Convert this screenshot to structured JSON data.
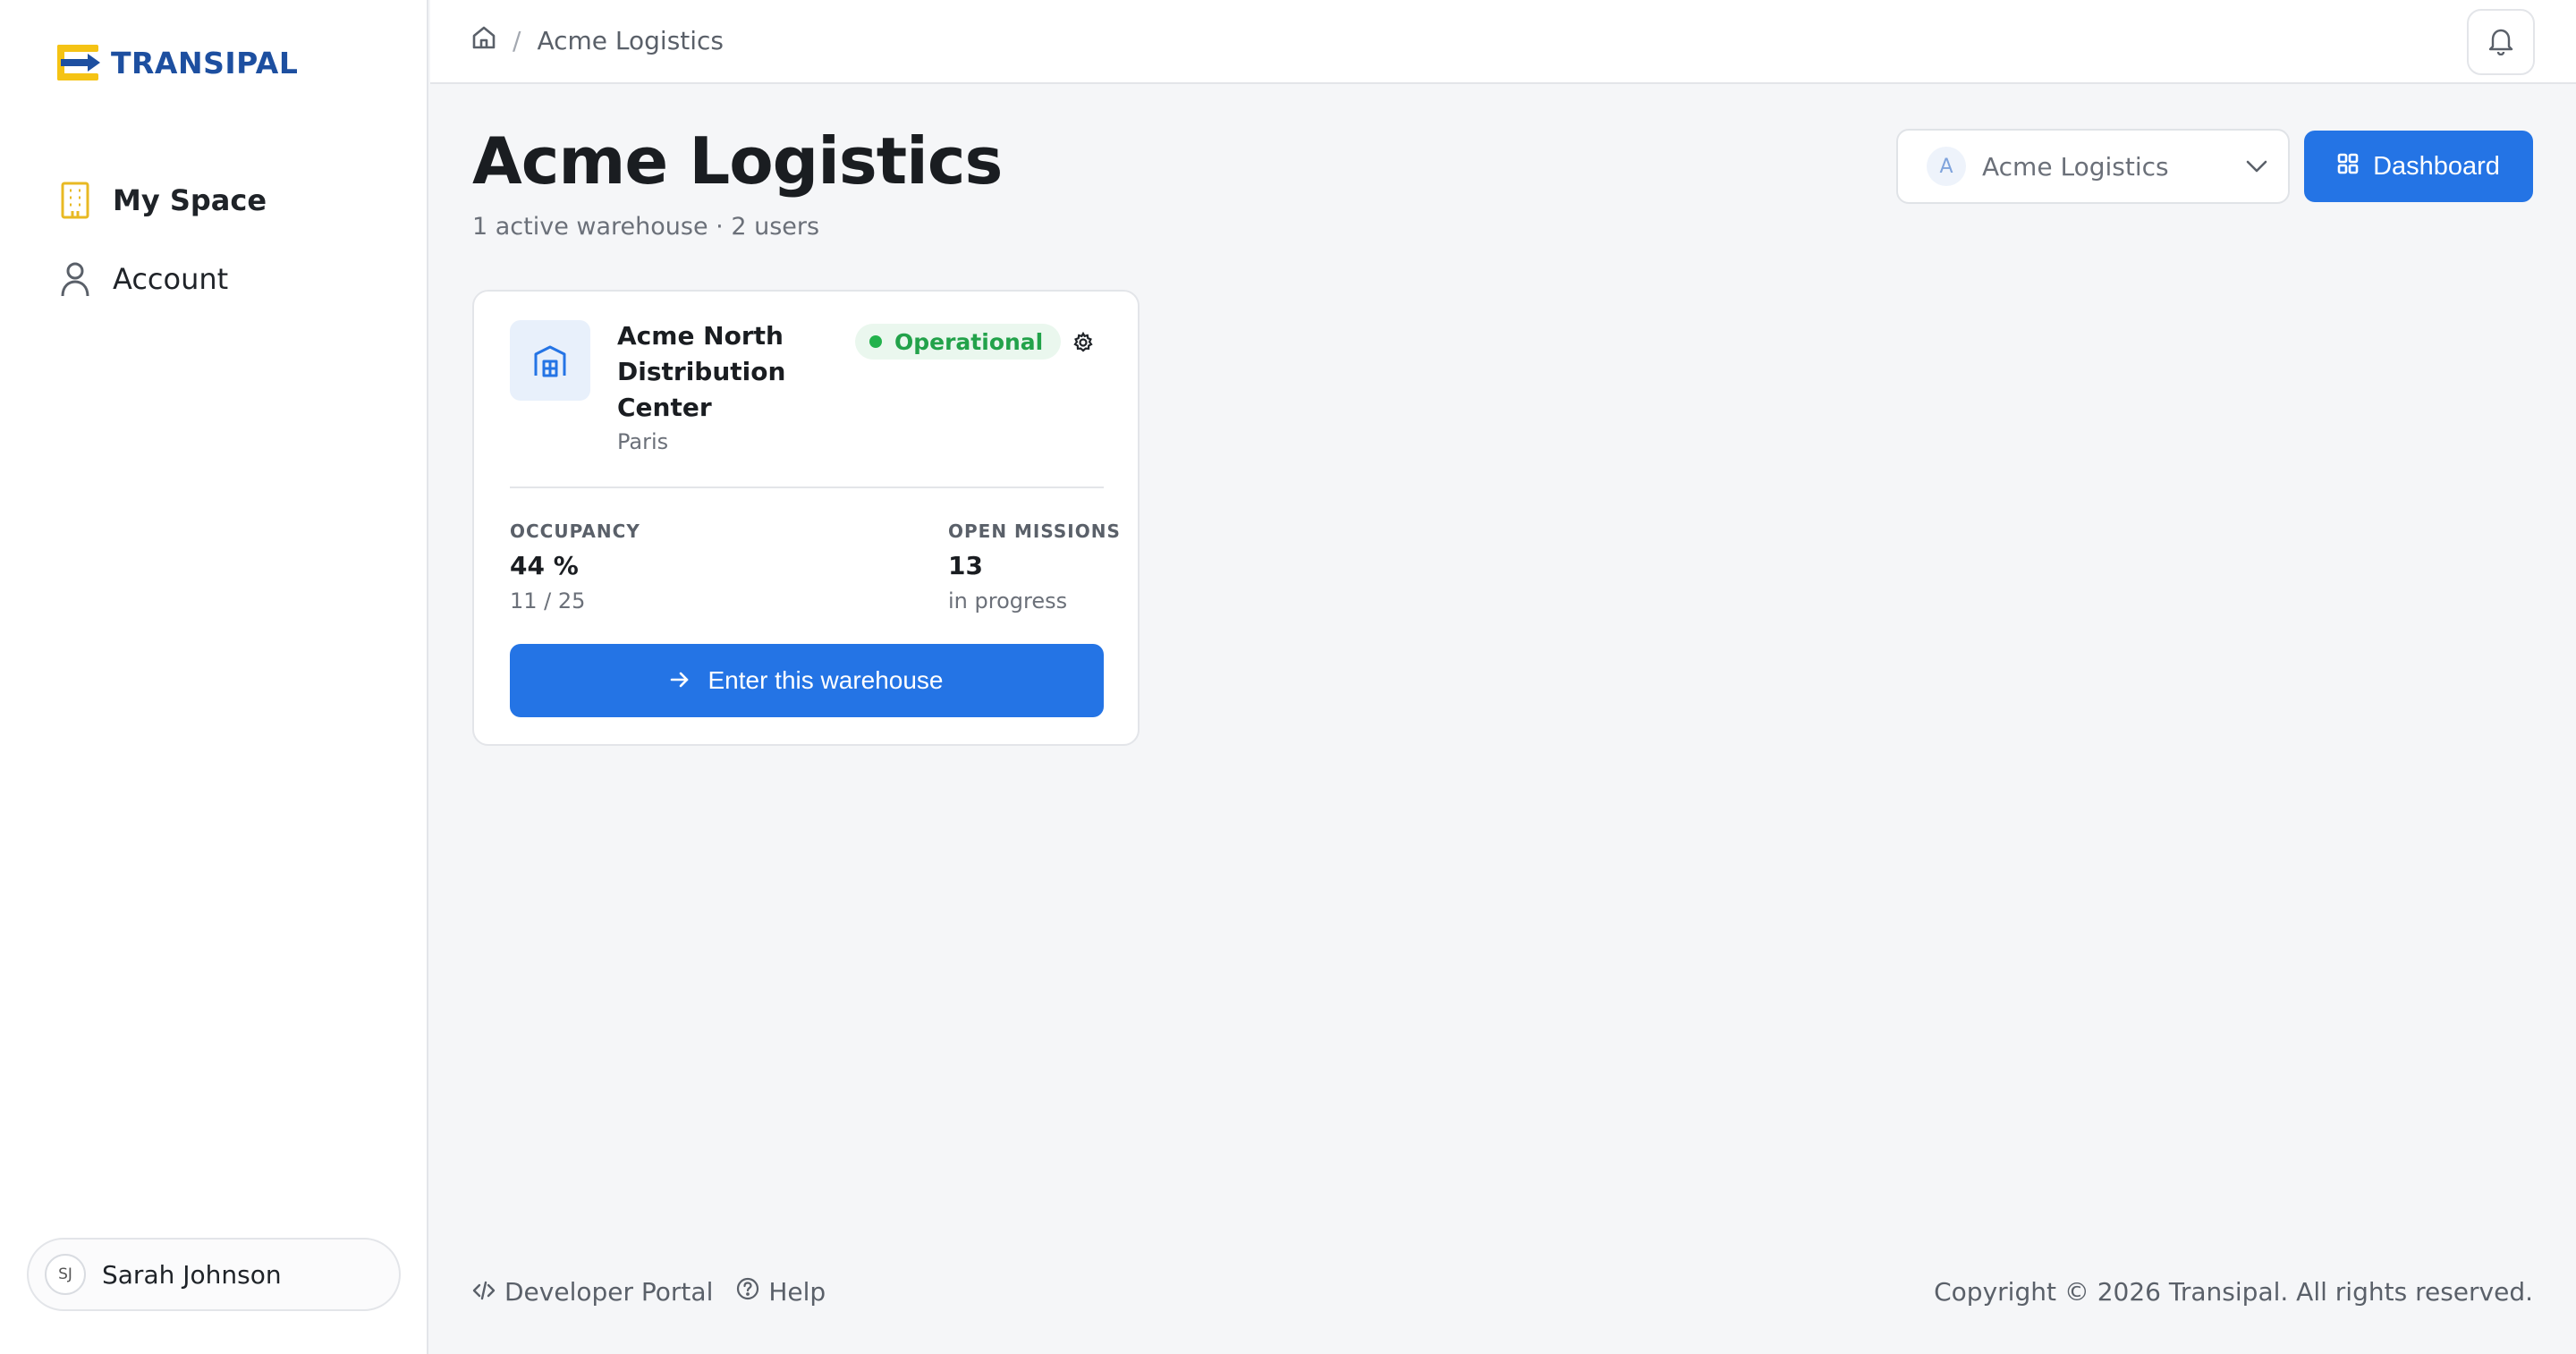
{
  "app": {
    "logo_text": "TRANSIPAL",
    "colors": {
      "brand_blue": "#1d4fa0",
      "brand_yellow": "#f5c314",
      "primary": "#2474e5",
      "success": "#22a24a"
    }
  },
  "sidebar": {
    "items": [
      {
        "label": "My Space",
        "icon": "building-icon",
        "active": true
      },
      {
        "label": "Account",
        "icon": "user-icon",
        "active": false
      }
    ],
    "user": {
      "initials": "SJ",
      "name": "Sarah Johnson"
    }
  },
  "topbar": {
    "breadcrumb": {
      "home_icon": "home-icon",
      "current": "Acme Logistics"
    },
    "bell_icon": "bell-icon"
  },
  "header": {
    "title": "Acme Logistics",
    "subtitle": "1 active warehouse · 2 users",
    "org_select": {
      "initial": "A",
      "value": "Acme Logistics"
    },
    "dashboard_label": "Dashboard"
  },
  "warehouse": {
    "name": "Acme North Distribution Center",
    "city": "Paris",
    "status": "Operational",
    "occupancy": {
      "label": "OCCUPANCY",
      "value": "44 %",
      "detail": "11 / 25"
    },
    "missions": {
      "label": "OPEN MISSIONS",
      "value": "13",
      "detail": "in progress"
    },
    "enter_label": "Enter this warehouse"
  },
  "footer": {
    "developer_portal": "Developer Portal",
    "help": "Help",
    "copyright": "Copyright © 2026 Transipal. All rights reserved."
  }
}
